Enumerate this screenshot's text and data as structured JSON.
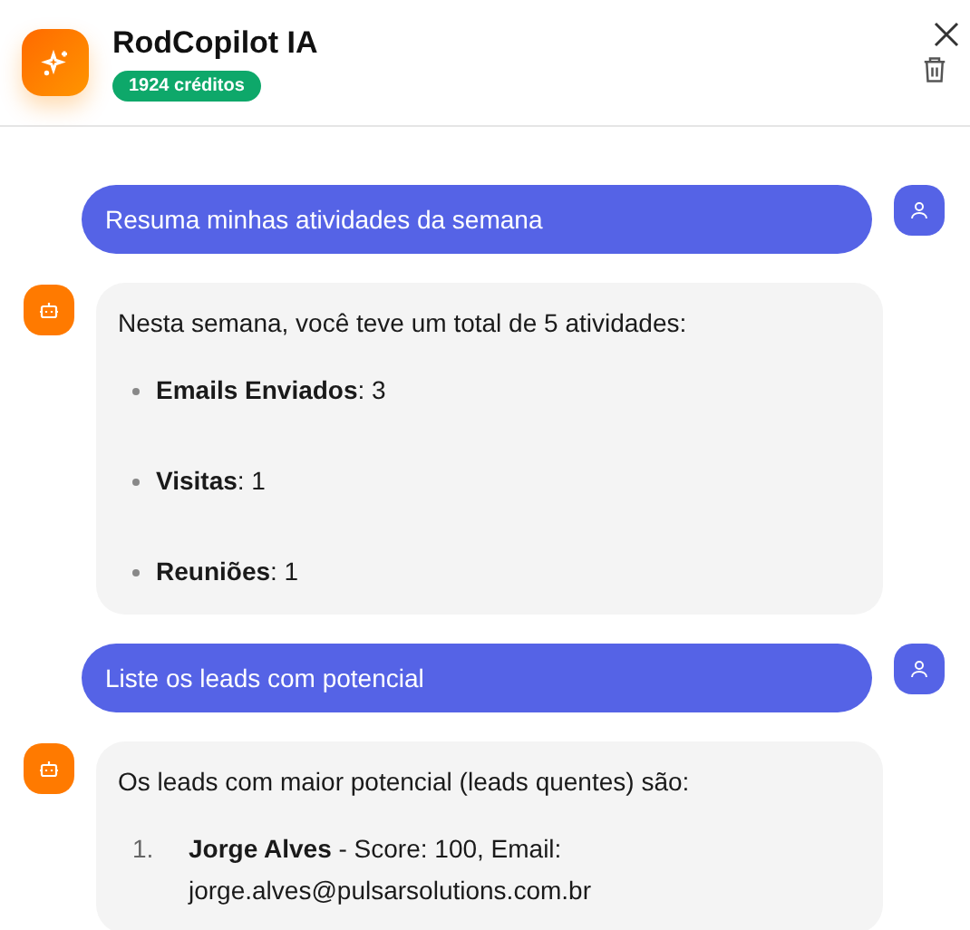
{
  "header": {
    "title": "RodCopilot IA",
    "credits": "1924 créditos"
  },
  "messages": [
    {
      "kind": "user",
      "text": "Resuma minhas atividades da semana"
    },
    {
      "kind": "assistant",
      "intro": "Nesta semana, você teve um total de 5 atividades:",
      "items": [
        {
          "kind": "bullet",
          "text": "**Emails Enviados**: 3"
        },
        {
          "kind": "bullet",
          "text": "**Visitas**: 1"
        },
        {
          "kind": "bullet",
          "text": "**Reuniões**: 1"
        }
      ]
    },
    {
      "kind": "user",
      "text": "Liste os leads com potencial"
    },
    {
      "kind": "assistant",
      "intro": "Os leads com maior potencial (leads quentes) são:",
      "items": [
        {
          "kind": "numbered",
          "number": "1.",
          "text": "**Jorge Alves** - Score: 100, Email: jorge.alves@pulsarsolutions.com.br"
        }
      ]
    }
  ]
}
